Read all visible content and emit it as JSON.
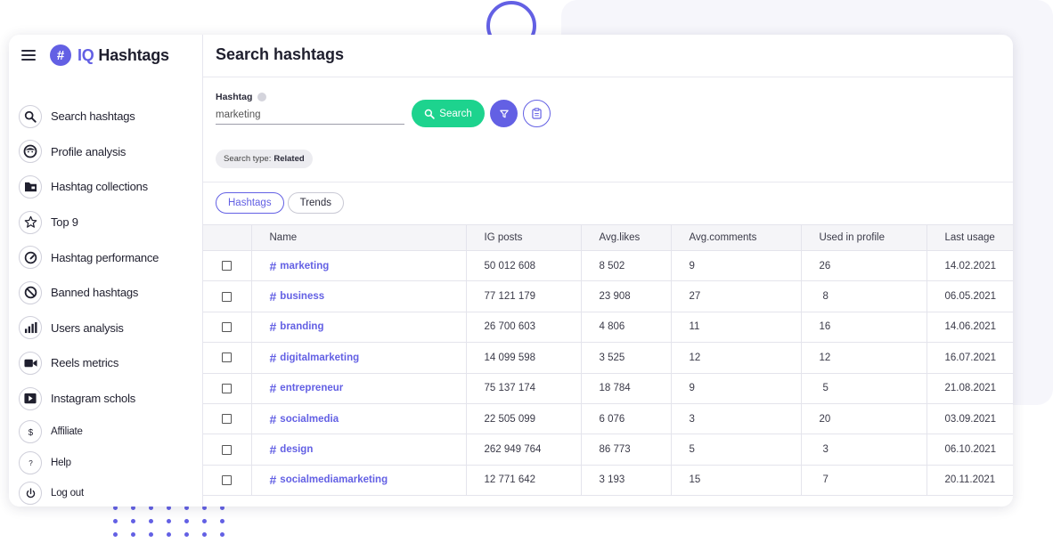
{
  "brand": {
    "logo_glyph": "#",
    "name_prefix": "IQ",
    "name_suffix": " Hashtags"
  },
  "sidebar": {
    "items": [
      {
        "label": "Search hashtags",
        "icon": "search-icon"
      },
      {
        "label": "Profile analysis",
        "icon": "profile-face-icon"
      },
      {
        "label": "Hashtag collections",
        "icon": "folder-icon"
      },
      {
        "label": "Top 9",
        "icon": "star-icon"
      },
      {
        "label": "Hashtag performance",
        "icon": "gauge-icon"
      },
      {
        "label": "Banned hashtags",
        "icon": "ban-icon"
      },
      {
        "label": "Users analysis",
        "icon": "bar-chart-icon"
      },
      {
        "label": "Reels metrics",
        "icon": "video-camera-icon"
      },
      {
        "label": "Instagram schols",
        "icon": "play-icon"
      }
    ],
    "secondary": [
      {
        "label": "Affiliate",
        "icon": "dollar-icon"
      },
      {
        "label": "Help",
        "icon": "question-icon"
      },
      {
        "label": "Log out",
        "icon": "power-icon"
      }
    ]
  },
  "main": {
    "title": "Search hashtags",
    "search": {
      "label": "Hashtag",
      "placeholder": "marketing",
      "button_label": "Search"
    },
    "chip": {
      "prefix": "Search type:",
      "value": "Related"
    },
    "tabs": [
      {
        "label": "Hashtags",
        "active": true
      },
      {
        "label": "Trends",
        "active": false
      }
    ],
    "table": {
      "columns": [
        "",
        "Name",
        "IG posts",
        "Avg.likes",
        "Avg.comments",
        "Used in profile",
        "Last usage"
      ],
      "rows": [
        {
          "name": "marketing",
          "ig_posts": "50 012 608",
          "avg_likes": "8 502",
          "avg_comments": "9",
          "used": "26",
          "last": "14.02.2021"
        },
        {
          "name": "business",
          "ig_posts": "77 121 179",
          "avg_likes": "23 908",
          "avg_comments": "27",
          "used": "8",
          "last": "06.05.2021"
        },
        {
          "name": "branding",
          "ig_posts": "26 700 603",
          "avg_likes": "4 806",
          "avg_comments": "11",
          "used": "16",
          "last": "14.06.2021"
        },
        {
          "name": "digitalmarketing",
          "ig_posts": "14 099 598",
          "avg_likes": "3 525",
          "avg_comments": "12",
          "used": "12",
          "last": "16.07.2021"
        },
        {
          "name": "entrepreneur",
          "ig_posts": "75 137 174",
          "avg_likes": "18 784",
          "avg_comments": "9",
          "used": "5",
          "last": "21.08.2021"
        },
        {
          "name": "socialmedia",
          "ig_posts": "22 505 099",
          "avg_likes": "6 076",
          "avg_comments": "3",
          "used": "20",
          "last": "03.09.2021"
        },
        {
          "name": "design",
          "ig_posts": "262 949 764",
          "avg_likes": "86 773",
          "avg_comments": "5",
          "used": "3",
          "last": "06.10.2021"
        },
        {
          "name": "socialmediamarketing",
          "ig_posts": "12 771 642",
          "avg_likes": "3 193",
          "avg_comments": "15",
          "used": "7",
          "last": "20.11.2021"
        }
      ]
    }
  },
  "colors": {
    "accent": "#6360e4",
    "search_button": "#1dd38e",
    "decor_dot": "#f7cf43"
  }
}
